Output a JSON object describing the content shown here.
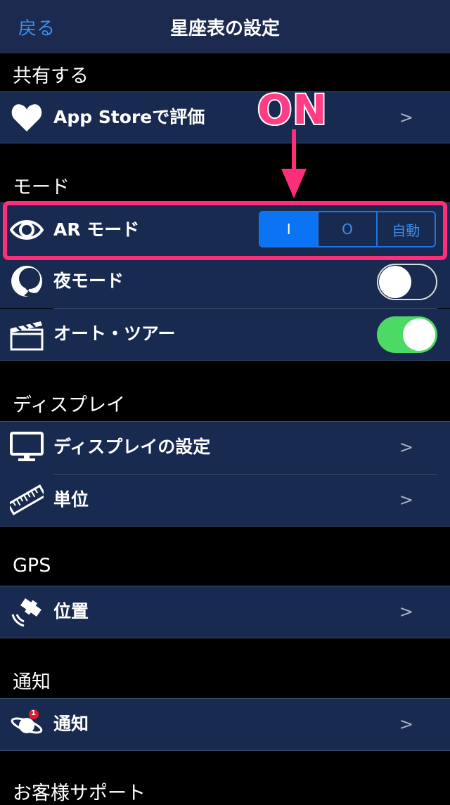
{
  "nav": {
    "back": "戻る",
    "title": "星座表の設定"
  },
  "sections": {
    "share": "共有する",
    "mode": "モード",
    "display": "ディスプレイ",
    "gps": "GPS",
    "notify": "通知",
    "support": "お客様サポート"
  },
  "rows": {
    "appstore": "App Storeで評価",
    "armode": "AR モード",
    "night": "夜モード",
    "tour": "オート・ツアー",
    "display": "ディスプレイの設定",
    "unit": "単位",
    "location": "位置",
    "notify": "通知"
  },
  "chevron": ">",
  "ar_segments": [
    "I",
    "O",
    "自動"
  ],
  "ar_selected": 0,
  "toggles": {
    "night": false,
    "tour": true
  },
  "annotation": "ON",
  "colors": {
    "nav_bg": "#1b2a4e",
    "row_bg": "#182a50",
    "accent": "#0a74f4",
    "highlight": "#ff2e7a",
    "toggle_on": "#4cd964"
  },
  "icons": {
    "appstore": "heart-icon",
    "armode": "eye-icon",
    "night": "moon-icon",
    "tour": "clapperboard-icon",
    "display": "monitor-icon",
    "unit": "ruler-icon",
    "location": "satellite-icon",
    "notify": "planet-badge-icon"
  },
  "badge": "1"
}
